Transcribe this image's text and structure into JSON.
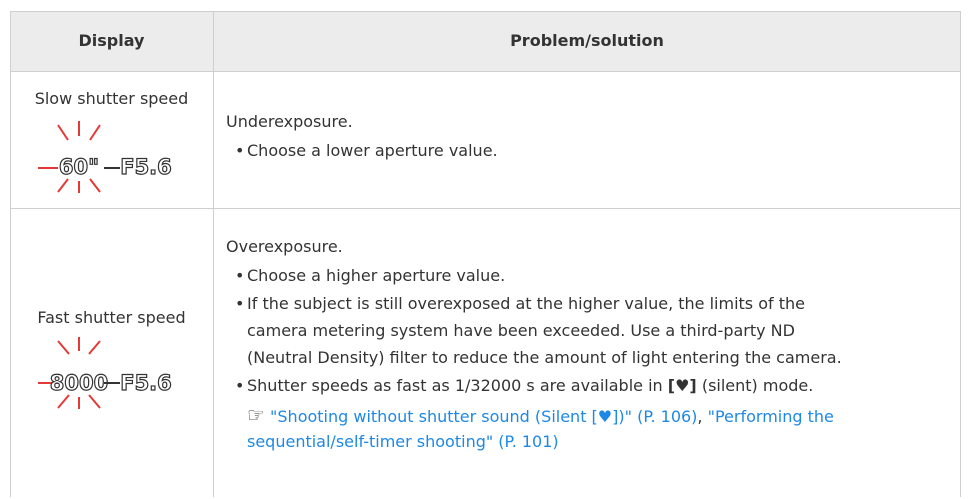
{
  "table": {
    "headers": {
      "display": "Display",
      "problem": "Problem/solution"
    },
    "rows": [
      {
        "label": "Slow shutter speed",
        "lcd": {
          "shutter": "60\"",
          "aperture": "F5.6"
        },
        "heading": "Underexposure.",
        "bullets": [
          "Choose a lower aperture value."
        ]
      },
      {
        "label": "Fast shutter speed",
        "lcd": {
          "shutter": "8000",
          "aperture": "F5.6"
        },
        "heading": "Overexposure.",
        "bullets": [
          "Choose a higher aperture value.",
          "If the subject is still overexposed at the higher value, the limits of the",
          "camera metering system have been exceeded. Use a third-party ND",
          "(Neutral Density) filter to reduce the amount of light entering the camera.",
          "Shutter speeds as fast as 1/32000 s are available in",
          "(silent) mode."
        ],
        "silent_symbol": "[♥]",
        "ref_icon": "☞",
        "ref1": "\"Shooting without shutter sound (Silent [♥])\" (P. 106)",
        "ref_sep": ",",
        "ref2a": "\"Performing the",
        "ref2b": "sequential/self-timer shooting\" (P. 101)"
      }
    ]
  },
  "colors": {
    "link": "#1e88e5",
    "header_bg": "#ececec",
    "text": "#333333",
    "border": "#cfcfcf"
  },
  "icons": {
    "flash_icon": "blink-lines-icon",
    "reference_icon": "see-page-icon"
  }
}
